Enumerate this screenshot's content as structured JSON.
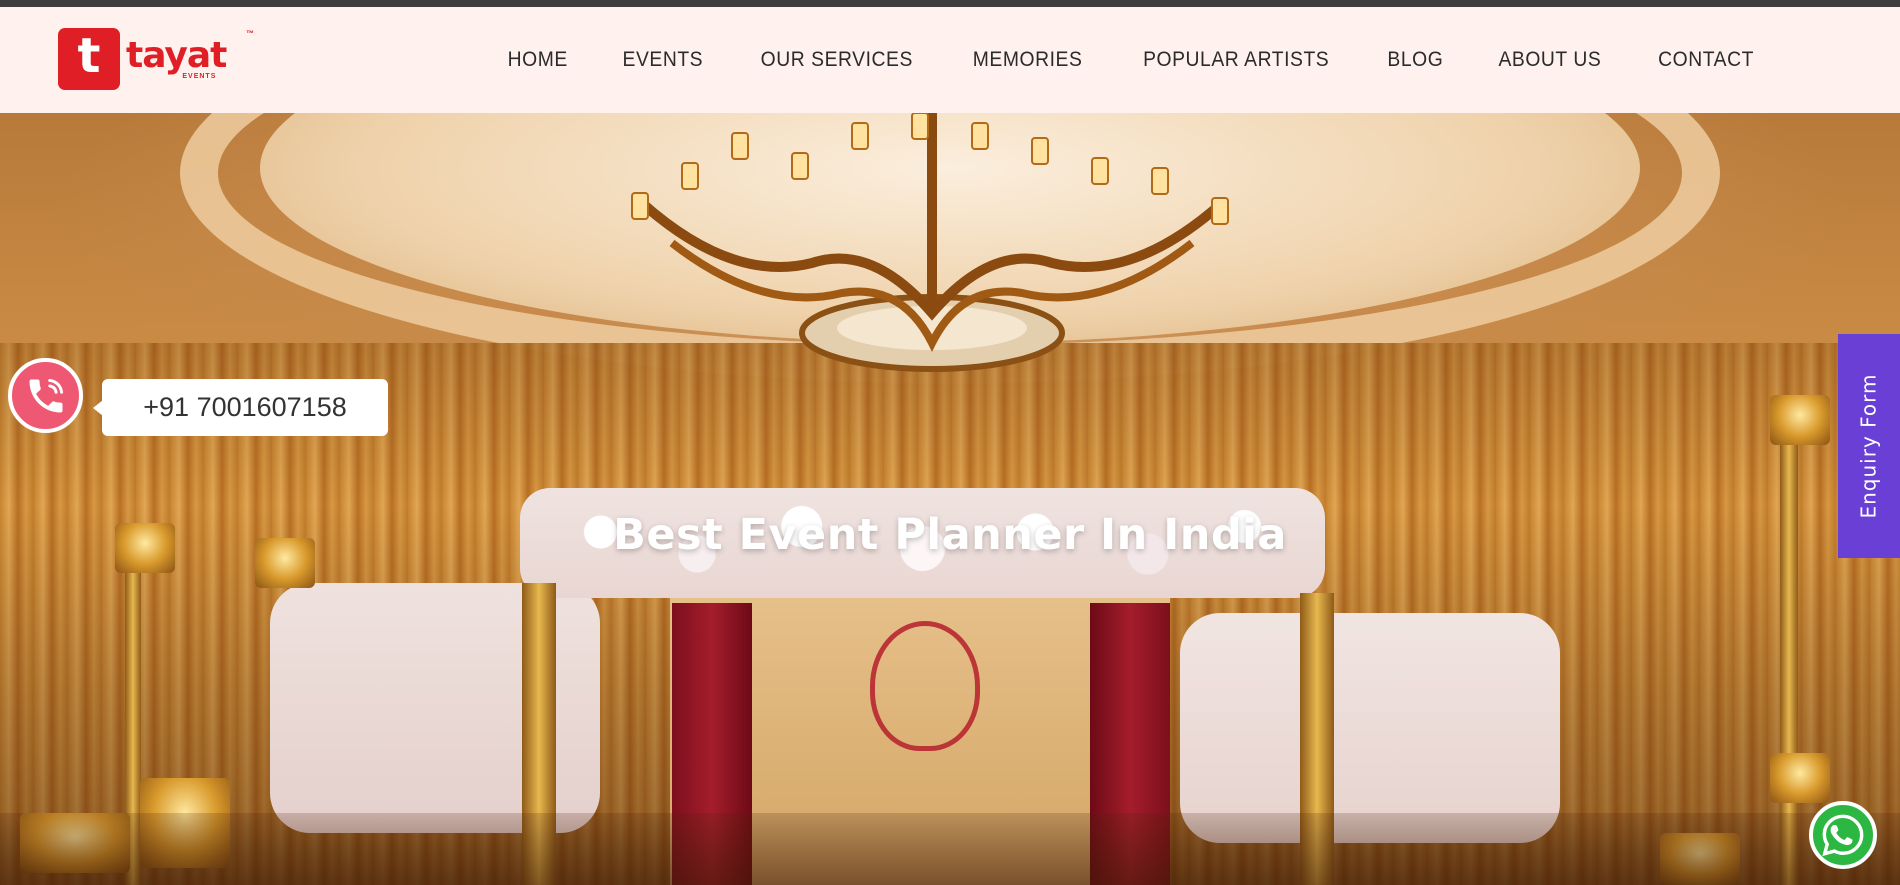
{
  "brand": {
    "logo_letter": "t",
    "name": "tayat",
    "trademark": "™",
    "subtitle": "EVENTS",
    "color": "#e01e26"
  },
  "nav": {
    "items": [
      {
        "label": "HOME"
      },
      {
        "label": "EVENTS"
      },
      {
        "label": "OUR SERVICES"
      },
      {
        "label": "MEMORIES"
      },
      {
        "label": "POPULAR ARTISTS"
      },
      {
        "label": "BLOG"
      },
      {
        "label": "ABOUT US"
      },
      {
        "label": "CONTACT"
      }
    ]
  },
  "hero": {
    "title": "Best Event Planner In India"
  },
  "call": {
    "icon": "phone-icon",
    "phone": "+91 7001607158",
    "color": "#ee5873"
  },
  "enquiry": {
    "label": "Enquiry Form",
    "color": "#6a3fd6"
  },
  "whatsapp": {
    "icon": "whatsapp-icon",
    "color": "#2bb741"
  }
}
